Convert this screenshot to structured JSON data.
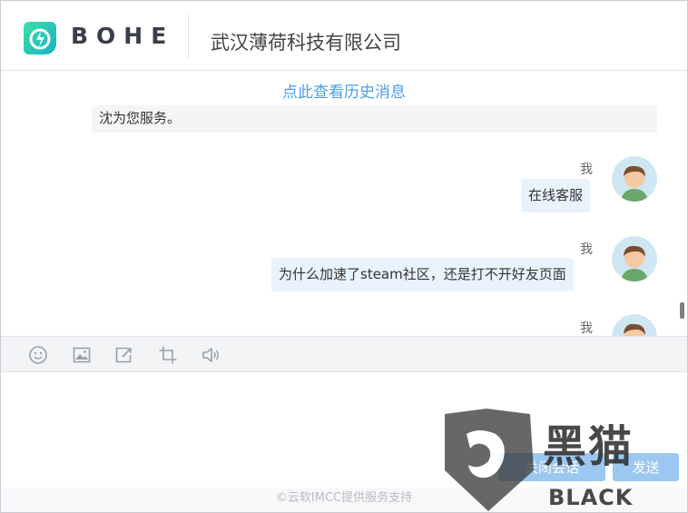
{
  "header": {
    "logo_text": "BOHE",
    "company": "武汉薄荷科技有限公司"
  },
  "chat": {
    "history_link": "点此查看历史消息",
    "messages": [
      {
        "side": "left",
        "text": "沈为您服务。"
      },
      {
        "side": "right",
        "sender": "我",
        "text": "在线客服"
      },
      {
        "side": "right",
        "sender": "我",
        "text": "为什么加速了steam社区，还是打不开好友页面"
      },
      {
        "side": "right",
        "sender": "我",
        "text": ""
      }
    ]
  },
  "toolbar": {
    "tools": [
      "emoji-icon",
      "image-icon",
      "screen-share-icon",
      "crop-icon",
      "voice-icon"
    ]
  },
  "input": {
    "value": ""
  },
  "buttons": {
    "close_label": "关闭会话",
    "send_label": "发送"
  },
  "footer": {
    "text": "©云软IMCC提供服务支持"
  },
  "watermark": {
    "cn": "黑猫",
    "en": "BLACK CAT"
  },
  "colors": {
    "accent": "#4a9ee8",
    "bubble_self": "#e9f3fd",
    "button": "#9cc7f0",
    "logo_green": "#2fd29b"
  }
}
